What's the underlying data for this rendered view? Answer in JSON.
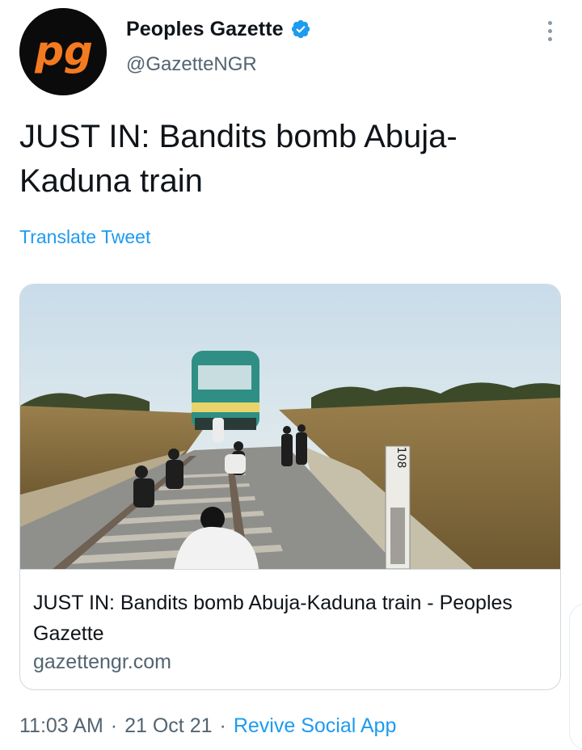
{
  "author": {
    "display_name": "Peoples Gazette",
    "handle": "@GazetteNGR",
    "avatar_text": "pg",
    "verified": true,
    "avatar_bg": "#0b0b0b",
    "avatar_fg": "#f47a20"
  },
  "tweet": {
    "text": "JUST IN: Bandits bomb Abuja-Kaduna train",
    "translate_label": "Translate Tweet"
  },
  "card": {
    "image_marker": "108",
    "title": "JUST IN: Bandits bomb Abuja-Kaduna train - Peoples Gazette",
    "domain": "gazettengr.com"
  },
  "meta": {
    "time": "11:03 AM",
    "separator": "·",
    "date": "21 Oct 21",
    "source": "Revive Social App"
  },
  "colors": {
    "link": "#1d9bf0",
    "secondary_text": "#536471",
    "primary_text": "#0f1419",
    "border": "#cfd9de"
  },
  "icons": [
    "verified-badge-icon",
    "more-options-icon"
  ]
}
